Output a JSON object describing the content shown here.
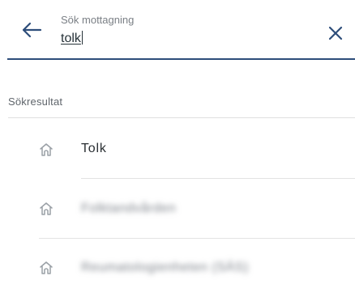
{
  "search": {
    "label": "Sök mottagning",
    "value": "tolk",
    "back_icon": "arrow-left-icon",
    "clear_icon": "close-icon",
    "accent_color": "#2d4d7a"
  },
  "results": {
    "section_label": "Sökresultat",
    "item_icon": "home-icon",
    "items": [
      {
        "label": "Tolk"
      },
      {
        "label": "Folktandvården"
      },
      {
        "label": "Reumatologienheten (SÄS)"
      }
    ]
  }
}
